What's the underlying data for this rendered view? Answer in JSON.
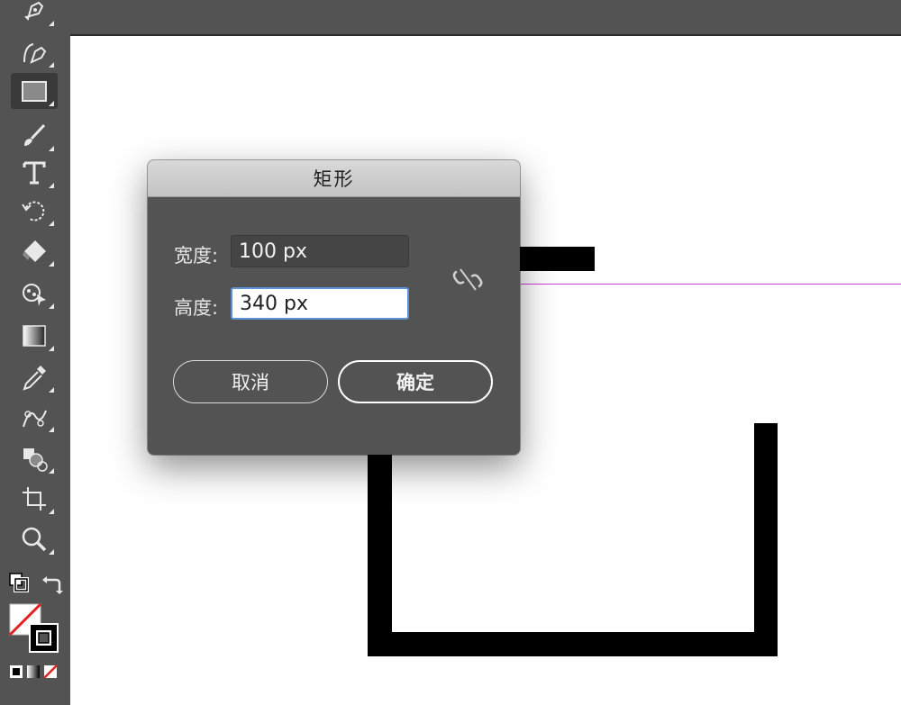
{
  "dialog": {
    "title": "矩形",
    "width_label": "宽度:",
    "width_value": "100 px",
    "height_label": "高度:",
    "height_value": "340 px",
    "link_icon": "unlink-chain-icon",
    "cancel_label": "取消",
    "ok_label": "确定"
  },
  "toolbar": {
    "tools": [
      "pen-icon",
      "curvature-pen-icon",
      "rectangle-tool-icon",
      "paintbrush-icon",
      "type-tool-icon",
      "rotate-icon",
      "eraser-icon",
      "puppet-warp-icon",
      "gradient-icon",
      "eyedropper-icon",
      "blend-icon",
      "shape-builder-icon",
      "artboard-icon",
      "zoom-icon",
      "default-colors-icon",
      "swap-colors-icon",
      "fill-none-icon",
      "stroke-icon",
      "color-mode-icon",
      "gradient-mode-icon",
      "none-mode-icon"
    ],
    "active_tool": "rectangle-tool-icon"
  },
  "colors": {
    "ui_gray": "#535353",
    "canvas": "#ffffff",
    "guide": "#d23ad8",
    "focus": "#5b93d6"
  }
}
